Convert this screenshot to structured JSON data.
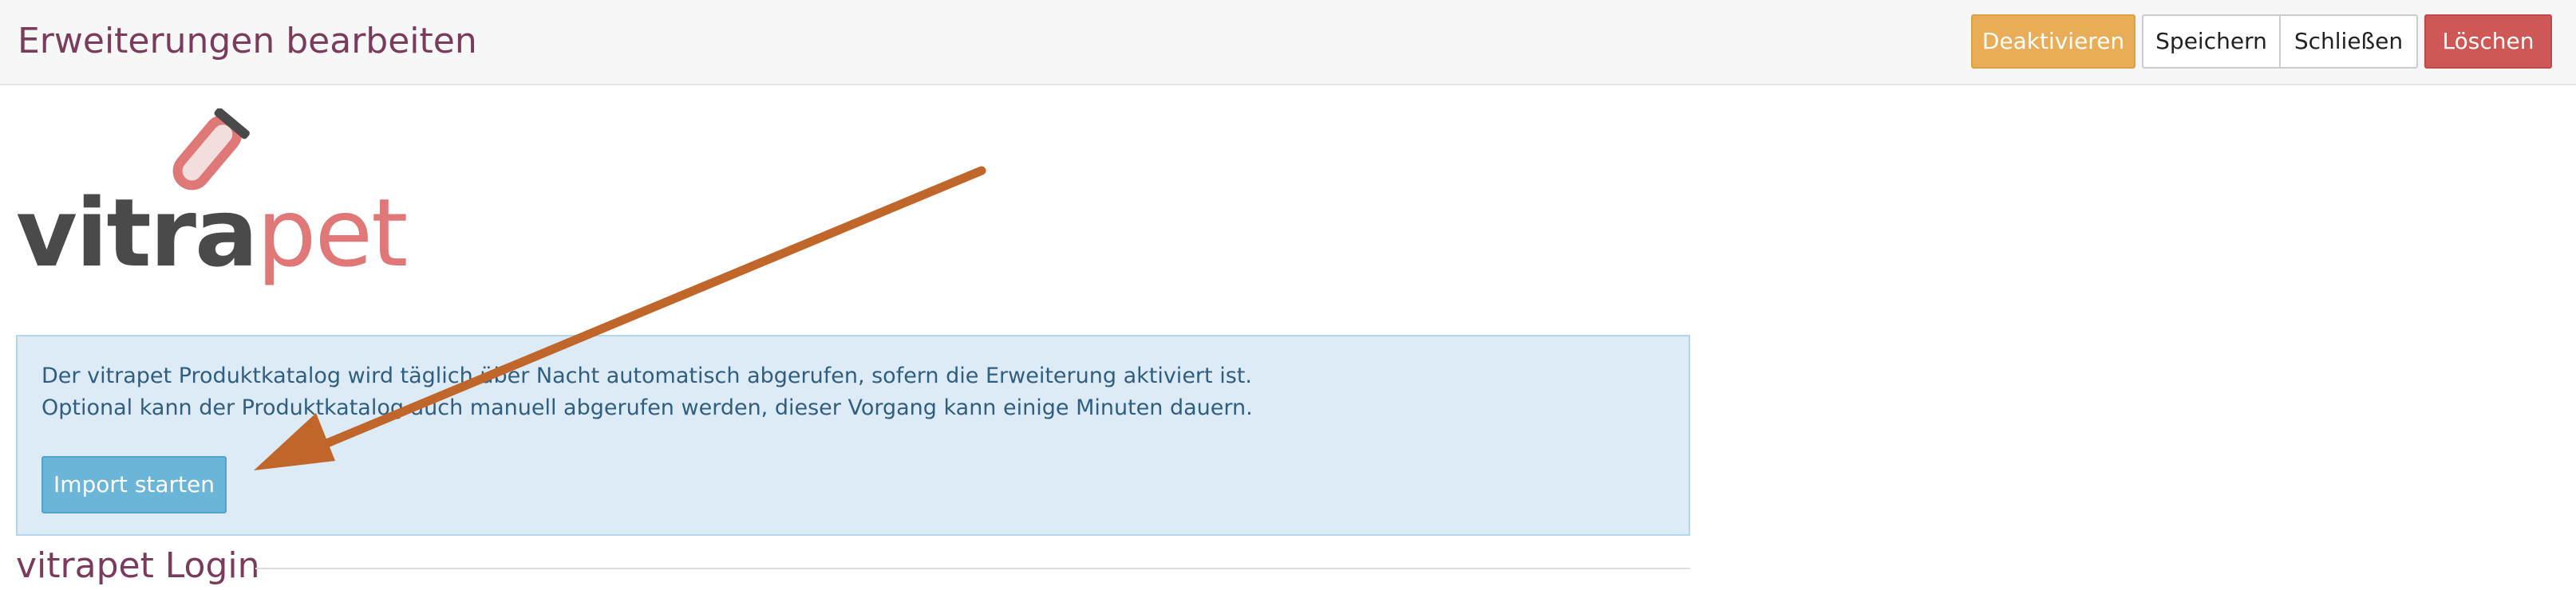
{
  "header": {
    "title": "Erweiterungen bearbeiten",
    "buttons": {
      "deactivate": "Deaktivieren",
      "save": "Speichern",
      "close": "Schließen",
      "delete": "Löschen"
    }
  },
  "logo": {
    "text_dark": "vitra",
    "text_light": "pet"
  },
  "info_box": {
    "line1": "Der vitrapet Produktkatalog wird täglich über Nacht automatisch abgerufen, sofern die Erweiterung aktiviert ist.",
    "line2": "Optional kann der Produktkatalog auch manuell abgerufen werden, dieser Vorgang kann einige Minuten dauern.",
    "import_button": "Import starten"
  },
  "login_section": {
    "heading": "vitrapet Login"
  },
  "colors": {
    "title": "#7a3b5c",
    "deactivate": "#e8ad56",
    "delete": "#cd5855",
    "info_bg": "#dcebf6",
    "import_button": "#6ab5d8",
    "annotation_arrow": "#c0662a"
  }
}
